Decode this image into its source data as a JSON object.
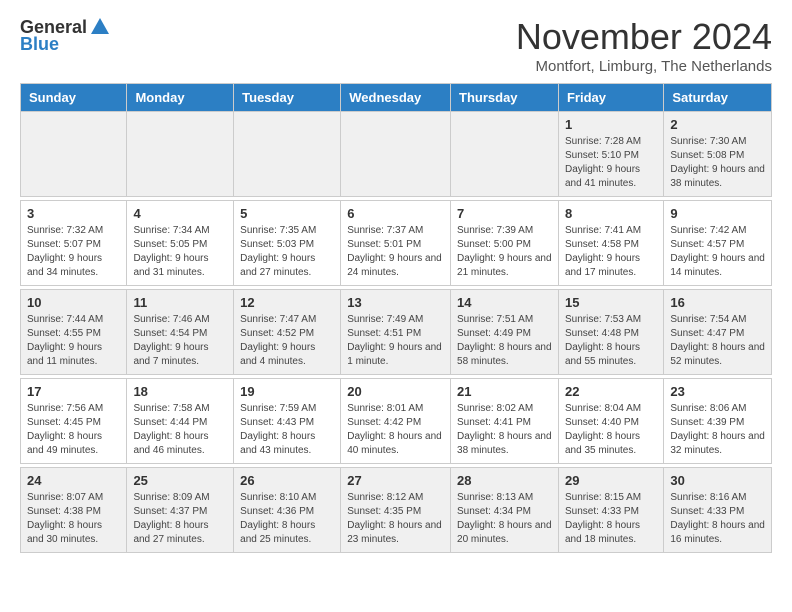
{
  "logo": {
    "general": "General",
    "blue": "Blue"
  },
  "title": "November 2024",
  "location": "Montfort, Limburg, The Netherlands",
  "headers": [
    "Sunday",
    "Monday",
    "Tuesday",
    "Wednesday",
    "Thursday",
    "Friday",
    "Saturday"
  ],
  "weeks": [
    [
      {
        "day": "",
        "info": ""
      },
      {
        "day": "",
        "info": ""
      },
      {
        "day": "",
        "info": ""
      },
      {
        "day": "",
        "info": ""
      },
      {
        "day": "",
        "info": ""
      },
      {
        "day": "1",
        "info": "Sunrise: 7:28 AM\nSunset: 5:10 PM\nDaylight: 9 hours and 41 minutes."
      },
      {
        "day": "2",
        "info": "Sunrise: 7:30 AM\nSunset: 5:08 PM\nDaylight: 9 hours and 38 minutes."
      }
    ],
    [
      {
        "day": "3",
        "info": "Sunrise: 7:32 AM\nSunset: 5:07 PM\nDaylight: 9 hours and 34 minutes."
      },
      {
        "day": "4",
        "info": "Sunrise: 7:34 AM\nSunset: 5:05 PM\nDaylight: 9 hours and 31 minutes."
      },
      {
        "day": "5",
        "info": "Sunrise: 7:35 AM\nSunset: 5:03 PM\nDaylight: 9 hours and 27 minutes."
      },
      {
        "day": "6",
        "info": "Sunrise: 7:37 AM\nSunset: 5:01 PM\nDaylight: 9 hours and 24 minutes."
      },
      {
        "day": "7",
        "info": "Sunrise: 7:39 AM\nSunset: 5:00 PM\nDaylight: 9 hours and 21 minutes."
      },
      {
        "day": "8",
        "info": "Sunrise: 7:41 AM\nSunset: 4:58 PM\nDaylight: 9 hours and 17 minutes."
      },
      {
        "day": "9",
        "info": "Sunrise: 7:42 AM\nSunset: 4:57 PM\nDaylight: 9 hours and 14 minutes."
      }
    ],
    [
      {
        "day": "10",
        "info": "Sunrise: 7:44 AM\nSunset: 4:55 PM\nDaylight: 9 hours and 11 minutes."
      },
      {
        "day": "11",
        "info": "Sunrise: 7:46 AM\nSunset: 4:54 PM\nDaylight: 9 hours and 7 minutes."
      },
      {
        "day": "12",
        "info": "Sunrise: 7:47 AM\nSunset: 4:52 PM\nDaylight: 9 hours and 4 minutes."
      },
      {
        "day": "13",
        "info": "Sunrise: 7:49 AM\nSunset: 4:51 PM\nDaylight: 9 hours and 1 minute."
      },
      {
        "day": "14",
        "info": "Sunrise: 7:51 AM\nSunset: 4:49 PM\nDaylight: 8 hours and 58 minutes."
      },
      {
        "day": "15",
        "info": "Sunrise: 7:53 AM\nSunset: 4:48 PM\nDaylight: 8 hours and 55 minutes."
      },
      {
        "day": "16",
        "info": "Sunrise: 7:54 AM\nSunset: 4:47 PM\nDaylight: 8 hours and 52 minutes."
      }
    ],
    [
      {
        "day": "17",
        "info": "Sunrise: 7:56 AM\nSunset: 4:45 PM\nDaylight: 8 hours and 49 minutes."
      },
      {
        "day": "18",
        "info": "Sunrise: 7:58 AM\nSunset: 4:44 PM\nDaylight: 8 hours and 46 minutes."
      },
      {
        "day": "19",
        "info": "Sunrise: 7:59 AM\nSunset: 4:43 PM\nDaylight: 8 hours and 43 minutes."
      },
      {
        "day": "20",
        "info": "Sunrise: 8:01 AM\nSunset: 4:42 PM\nDaylight: 8 hours and 40 minutes."
      },
      {
        "day": "21",
        "info": "Sunrise: 8:02 AM\nSunset: 4:41 PM\nDaylight: 8 hours and 38 minutes."
      },
      {
        "day": "22",
        "info": "Sunrise: 8:04 AM\nSunset: 4:40 PM\nDaylight: 8 hours and 35 minutes."
      },
      {
        "day": "23",
        "info": "Sunrise: 8:06 AM\nSunset: 4:39 PM\nDaylight: 8 hours and 32 minutes."
      }
    ],
    [
      {
        "day": "24",
        "info": "Sunrise: 8:07 AM\nSunset: 4:38 PM\nDaylight: 8 hours and 30 minutes."
      },
      {
        "day": "25",
        "info": "Sunrise: 8:09 AM\nSunset: 4:37 PM\nDaylight: 8 hours and 27 minutes."
      },
      {
        "day": "26",
        "info": "Sunrise: 8:10 AM\nSunset: 4:36 PM\nDaylight: 8 hours and 25 minutes."
      },
      {
        "day": "27",
        "info": "Sunrise: 8:12 AM\nSunset: 4:35 PM\nDaylight: 8 hours and 23 minutes."
      },
      {
        "day": "28",
        "info": "Sunrise: 8:13 AM\nSunset: 4:34 PM\nDaylight: 8 hours and 20 minutes."
      },
      {
        "day": "29",
        "info": "Sunrise: 8:15 AM\nSunset: 4:33 PM\nDaylight: 8 hours and 18 minutes."
      },
      {
        "day": "30",
        "info": "Sunrise: 8:16 AM\nSunset: 4:33 PM\nDaylight: 8 hours and 16 minutes."
      }
    ]
  ]
}
